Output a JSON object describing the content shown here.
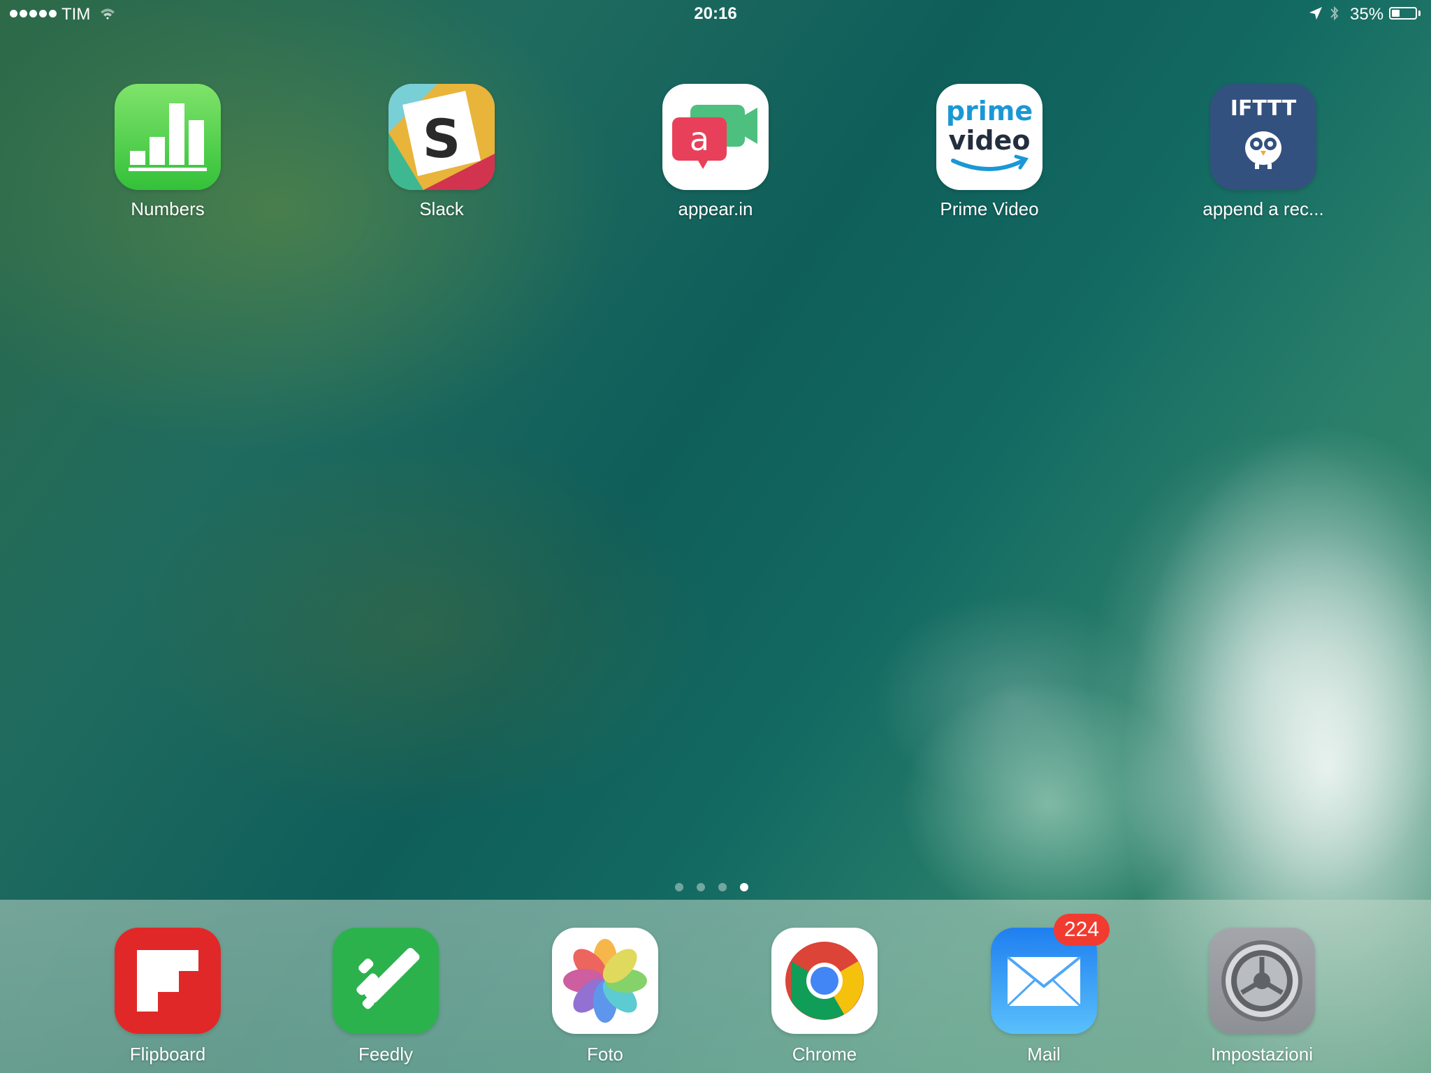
{
  "status_bar": {
    "carrier": "TIM",
    "time": "20:16",
    "battery_percent": "35%",
    "battery_level": 0.35,
    "signal_bars": 5,
    "icons": [
      "wifi-icon",
      "location-icon",
      "bluetooth-icon",
      "battery-icon"
    ]
  },
  "home_apps": [
    {
      "label": "Numbers",
      "icon": "numbers-icon"
    },
    {
      "label": "Slack",
      "icon": "slack-icon"
    },
    {
      "label": "appear.in",
      "icon": "appearin-icon"
    },
    {
      "label": "Prime Video",
      "icon": "prime-video-icon",
      "icon_text_1": "prime",
      "icon_text_2": "video"
    },
    {
      "label": "append a rec...",
      "icon": "ifttt-icon",
      "icon_text": "IFTTT"
    }
  ],
  "page_indicator": {
    "pages": 4,
    "current": 4
  },
  "dock_apps": [
    {
      "label": "Flipboard",
      "icon": "flipboard-icon"
    },
    {
      "label": "Feedly",
      "icon": "feedly-icon"
    },
    {
      "label": "Foto",
      "icon": "photos-icon"
    },
    {
      "label": "Chrome",
      "icon": "chrome-icon"
    },
    {
      "label": "Mail",
      "icon": "mail-icon",
      "badge": "224"
    },
    {
      "label": "Impostazioni",
      "icon": "settings-icon"
    }
  ],
  "colors": {
    "numbers": "#3fc83a",
    "appearin_red": "#e8405a",
    "appearin_green": "#4dbf7e",
    "prime_blue": "#1a98d5",
    "ifttt_blue": "#33517f",
    "flipboard": "#e12828",
    "feedly": "#2bb24c",
    "mail": "#1e88f5",
    "badge": "#f23b30"
  }
}
